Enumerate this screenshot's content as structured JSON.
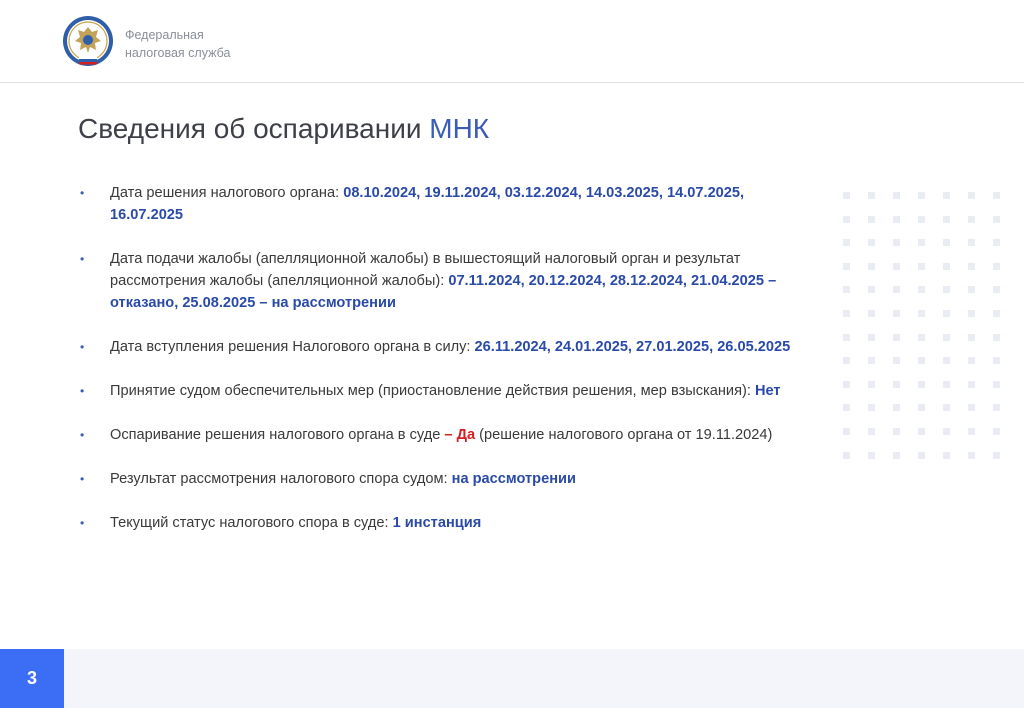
{
  "header": {
    "emblem": "fns-emblem-icon",
    "org_line1": "Федеральная",
    "org_line2": "налоговая служба"
  },
  "title": {
    "main": "Сведения об оспаривании ",
    "accent": "МНК"
  },
  "items": [
    {
      "parts": [
        {
          "text": "Дата решения налогового органа: ",
          "style": "normal"
        },
        {
          "text": "08.10.2024, 19.11.2024, 03.12.2024, 14.03.2025, 14.07.2025, 16.07.2025",
          "style": "hl"
        }
      ]
    },
    {
      "parts": [
        {
          "text": "Дата подачи жалобы (апелляционной жалобы) в вышестоящий налоговый орган и результат рассмотрения жалобы (апелляционной жалобы): ",
          "style": "normal"
        },
        {
          "text": "07.11.2024, 20.12.2024, 28.12.2024, 21.04.2025 – отказано, 25.08.2025 – на рассмотрении",
          "style": "hl"
        }
      ]
    },
    {
      "parts": [
        {
          "text": "Дата вступления решения Налогового органа в силу: ",
          "style": "normal"
        },
        {
          "text": "26.11.2024, 24.01.2025, 27.01.2025, 26.05.2025",
          "style": "hl"
        }
      ]
    },
    {
      "parts": [
        {
          "text": "Принятие судом обеспечительных мер (приостановление действия решения, мер взыскания): ",
          "style": "normal"
        },
        {
          "text": "Нет",
          "style": "hl"
        }
      ]
    },
    {
      "parts": [
        {
          "text": "Оспаривание решения налогового органа в суде ",
          "style": "normal"
        },
        {
          "text": "– Да",
          "style": "red"
        },
        {
          "text": " (решение налогового органа от 19.11.2024)",
          "style": "normal"
        }
      ]
    },
    {
      "parts": [
        {
          "text": "Результат рассмотрения налогового спора судом: ",
          "style": "normal"
        },
        {
          "text": "на рассмотрении",
          "style": "hl"
        }
      ]
    },
    {
      "parts": [
        {
          "text": "Текущий статус налогового спора в суде: ",
          "style": "normal"
        },
        {
          "text": "1 инстанция",
          "style": "hl"
        }
      ]
    }
  ],
  "bullet_glyph": "•",
  "page_number": "3",
  "colors": {
    "accent": "#3a5bb8",
    "highlight": "#2a4aa8",
    "red": "#d42020",
    "page_badge": "#3b6ef5"
  }
}
